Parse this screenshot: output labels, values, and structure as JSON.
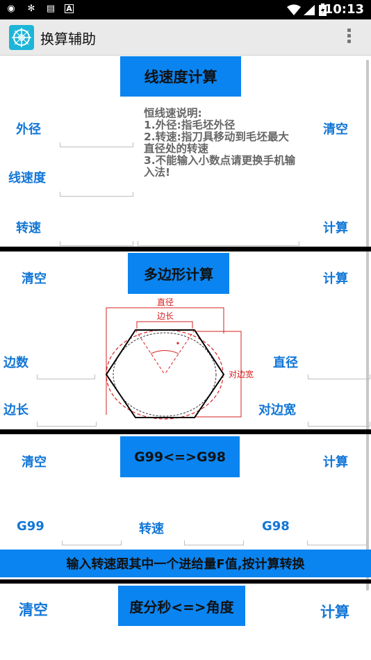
{
  "status_bar": {
    "time": "10:13",
    "icons": [
      "whatsapp-like-icon",
      "settings-icon",
      "message-icon",
      "a-icon",
      "wifi-icon",
      "signal-icon",
      "battery-icon"
    ]
  },
  "app_bar": {
    "title": "换算辅助",
    "icon": "app-compass-icon",
    "menu_icon": "overflow-menu-icon"
  },
  "linear_speed": {
    "title": "线速度计算",
    "outer_diameter_label": "外径",
    "linear_speed_label": "线速度",
    "rpm_label": "转速",
    "clear_label": "清空",
    "calc_label": "计算",
    "note": "恒线速说明:\n1.外径:指毛坯外径\n2.转速:指刀具移动到毛坯最大直径处的转速\n3.不能输入小数点请更换手机输入法!"
  },
  "polygon": {
    "title": "多边形计算",
    "clear_label": "清空",
    "calc_label": "计算",
    "sides_label": "边数",
    "side_length_label": "边长",
    "diameter_label": "直径",
    "across_flats_label": "对边宽",
    "diagram": {
      "label_diameter": "直径",
      "label_side": "边长",
      "label_across": "对边宽"
    }
  },
  "g99_g98": {
    "title": "G99<=>G98",
    "clear_label": "清空",
    "calc_label": "计算",
    "g99_label": "G99",
    "rpm_label": "转速",
    "g98_label": "G98",
    "banner": "输入转速跟其中一个进给量F值,按计算转换"
  },
  "dms": {
    "title": "度分秒<=>角度",
    "clear_label": "清空",
    "calc_label": "计算"
  },
  "colors": {
    "accent_blue": "#0a84f0",
    "label_blue": "#1176d6",
    "diagram_red": "#d62020"
  }
}
